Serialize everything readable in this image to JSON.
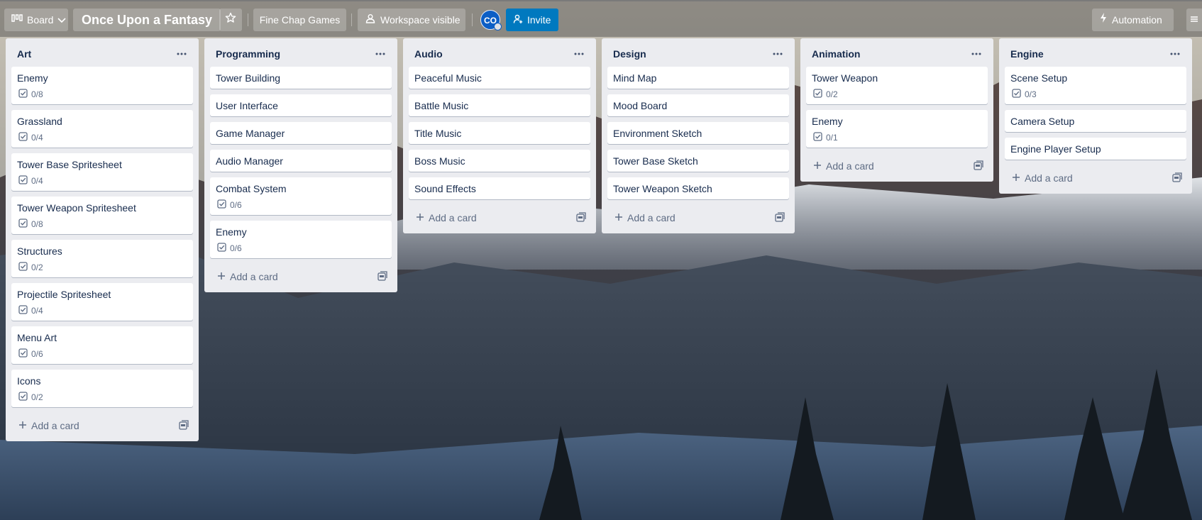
{
  "header": {
    "view_label": "Board",
    "board_title": "Once Upon a Fantasy",
    "workspace_name": "Fine Chap Games",
    "visibility_label": "Workspace visible",
    "avatar_initials": "CO",
    "invite_label": "Invite",
    "automation_label": "Automation"
  },
  "add_card_label": "Add a card",
  "lists": [
    {
      "title": "Art",
      "cards": [
        {
          "title": "Enemy",
          "checklist": "0/8"
        },
        {
          "title": "Grassland",
          "checklist": "0/4"
        },
        {
          "title": "Tower Base Spritesheet",
          "checklist": "0/4"
        },
        {
          "title": "Tower Weapon Spritesheet",
          "checklist": "0/8"
        },
        {
          "title": "Structures",
          "checklist": "0/2"
        },
        {
          "title": "Projectile Spritesheet",
          "checklist": "0/4"
        },
        {
          "title": "Menu Art",
          "checklist": "0/6"
        },
        {
          "title": "Icons",
          "checklist": "0/2"
        }
      ]
    },
    {
      "title": "Programming",
      "cards": [
        {
          "title": "Tower Building"
        },
        {
          "title": "User Interface"
        },
        {
          "title": "Game Manager"
        },
        {
          "title": "Audio Manager"
        },
        {
          "title": "Combat System",
          "checklist": "0/6"
        },
        {
          "title": "Enemy",
          "checklist": "0/6"
        }
      ]
    },
    {
      "title": "Audio",
      "cards": [
        {
          "title": "Peaceful Music"
        },
        {
          "title": "Battle Music"
        },
        {
          "title": "Title Music"
        },
        {
          "title": "Boss Music"
        },
        {
          "title": "Sound Effects"
        }
      ]
    },
    {
      "title": "Design",
      "cards": [
        {
          "title": "Mind Map"
        },
        {
          "title": "Mood Board"
        },
        {
          "title": "Environment Sketch"
        },
        {
          "title": "Tower Base Sketch"
        },
        {
          "title": "Tower Weapon Sketch"
        }
      ]
    },
    {
      "title": "Animation",
      "cards": [
        {
          "title": "Tower Weapon",
          "checklist": "0/2"
        },
        {
          "title": "Enemy",
          "checklist": "0/1"
        }
      ]
    },
    {
      "title": "Engine",
      "cards": [
        {
          "title": "Scene Setup",
          "checklist": "0/3"
        },
        {
          "title": "Camera Setup"
        },
        {
          "title": "Engine Player Setup"
        }
      ]
    }
  ],
  "colors": {
    "list_bg": "#ebecf0",
    "card_bg": "#ffffff",
    "text": "#172b4d",
    "muted": "#5e6c84",
    "invite_bg": "#0079bf",
    "avatar_bg": "#0c5ec5"
  },
  "icons": {
    "board_view": "board-icon",
    "star": "star-icon",
    "visibility": "people-icon",
    "invite": "add-user-icon",
    "automation": "lightning-icon",
    "list_menu": "more-icon",
    "checklist": "checkbox-icon",
    "add": "plus-icon",
    "template": "card-template-icon"
  }
}
